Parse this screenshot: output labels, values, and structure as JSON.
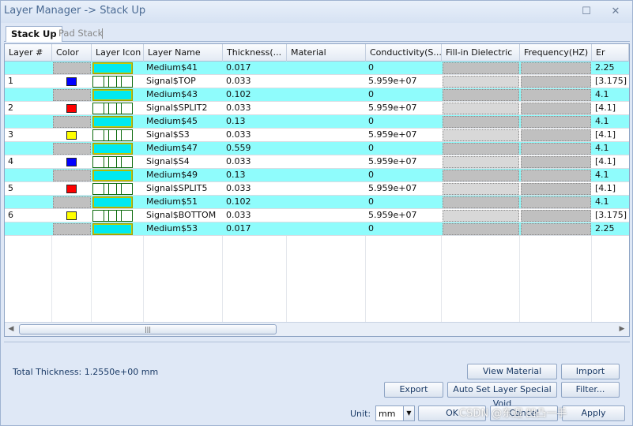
{
  "window": {
    "title": "Layer Manager -> Stack Up",
    "minimize_glyph": "☐",
    "close_glyph": "✕"
  },
  "tabs": [
    {
      "label": "Stack Up",
      "active": true
    },
    {
      "label": "Pad Stack",
      "active": false
    }
  ],
  "columns": [
    "Layer #",
    "Color",
    "Layer Icon",
    "Layer Name",
    "Thickness(...",
    "Material",
    "Conductivity(S...",
    "Fill-in Dielectric",
    "Frequency(HZ)",
    "Er"
  ],
  "rows": [
    {
      "type": "dielectric",
      "layer": "",
      "color": "",
      "name": "Medium$41",
      "thickness": "0.017",
      "material": "",
      "conductivity": "0",
      "er": "2.25"
    },
    {
      "type": "signal",
      "layer": "1",
      "color": "#0000ff",
      "name": "Signal$TOP",
      "thickness": "0.033",
      "material": "",
      "conductivity": "5.959e+07",
      "er": "[3.175]"
    },
    {
      "type": "dielectric",
      "layer": "",
      "color": "",
      "name": "Medium$43",
      "thickness": "0.102",
      "material": "",
      "conductivity": "0",
      "er": "4.1"
    },
    {
      "type": "signal",
      "layer": "2",
      "color": "#ff0000",
      "name": "Signal$SPLIT2",
      "thickness": "0.033",
      "material": "",
      "conductivity": "5.959e+07",
      "er": "[4.1]"
    },
    {
      "type": "dielectric",
      "layer": "",
      "color": "",
      "name": "Medium$45",
      "thickness": "0.13",
      "material": "",
      "conductivity": "0",
      "er": "4.1"
    },
    {
      "type": "signal",
      "layer": "3",
      "color": "#ffff00",
      "name": "Signal$S3",
      "thickness": "0.033",
      "material": "",
      "conductivity": "5.959e+07",
      "er": "[4.1]"
    },
    {
      "type": "dielectric",
      "layer": "",
      "color": "",
      "name": "Medium$47",
      "thickness": "0.559",
      "material": "",
      "conductivity": "0",
      "er": "4.1"
    },
    {
      "type": "signal",
      "layer": "4",
      "color": "#0000ff",
      "name": "Signal$S4",
      "thickness": "0.033",
      "material": "",
      "conductivity": "5.959e+07",
      "er": "[4.1]"
    },
    {
      "type": "dielectric",
      "layer": "",
      "color": "",
      "name": "Medium$49",
      "thickness": "0.13",
      "material": "",
      "conductivity": "0",
      "er": "4.1"
    },
    {
      "type": "signal",
      "layer": "5",
      "color": "#ff0000",
      "name": "Signal$SPLIT5",
      "thickness": "0.033",
      "material": "",
      "conductivity": "5.959e+07",
      "er": "[4.1]"
    },
    {
      "type": "dielectric",
      "layer": "",
      "color": "",
      "name": "Medium$51",
      "thickness": "0.102",
      "material": "",
      "conductivity": "0",
      "er": "4.1"
    },
    {
      "type": "signal",
      "layer": "6",
      "color": "#ffff00",
      "name": "Signal$BOTTOM",
      "thickness": "0.033",
      "material": "",
      "conductivity": "5.959e+07",
      "er": "[3.175]"
    },
    {
      "type": "dielectric",
      "layer": "",
      "color": "",
      "name": "Medium$53",
      "thickness": "0.017",
      "material": "",
      "conductivity": "0",
      "er": "2.25"
    }
  ],
  "scrollbar": {
    "thumb_glyph": "|||",
    "left_arrow": "◀",
    "right_arrow": "▶"
  },
  "footer": {
    "total_label": "Total Thickness:",
    "total_value": "1.2550e+00 mm",
    "view_material": "View Material",
    "import": "Import",
    "export": "Export",
    "auto_set": "Auto Set Layer Special Void",
    "filter": "Filter...",
    "unit_label": "Unit:",
    "unit_value": "mm",
    "ok": "OK",
    "cancel": "Cancel",
    "apply": "Apply"
  },
  "watermark": "CSDN @东迎 凹凸一手"
}
